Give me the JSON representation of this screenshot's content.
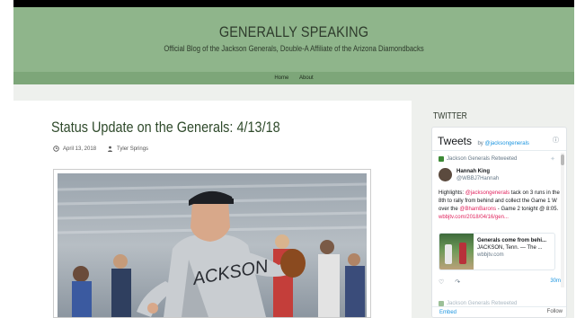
{
  "site": {
    "title": "GENERALLY SPEAKING",
    "tagline": "Official Blog of the Jackson Generals, Double-A Affiliate of the Arizona Diamondbacks"
  },
  "nav": {
    "items": [
      "Home",
      "About"
    ]
  },
  "post": {
    "title": "Status Update on the Generals: 4/13/18",
    "date": "April 13, 2018",
    "author": "Tyler Springs",
    "photo_jersey_text": "ACKSON"
  },
  "sidebar": {
    "title": "TWITTER",
    "widget": {
      "heading": "Tweets",
      "by": "by",
      "handle": "@jacksongenerals",
      "info_icon": "info-icon",
      "retweeted_label": "Jackson Generals Retweeted",
      "tweet": {
        "name": "Hannah King",
        "handle": "@WBBJ7Hannah",
        "text_before": "Highlights: ",
        "mention": "@jacksongenerals",
        "text_mid": " tack on 3 runs in the 8th to rally from behind and collect the Game 1 W over the ",
        "mention2": "@BhamBarons",
        "text_after": " - Game 2 tonight @ 8:05. ",
        "link": "wbbjtv.com/2018/04/16/gen...",
        "card_title": "Generals come from behi...",
        "card_desc": "JACKSON, Tenn. — The ...",
        "card_url": "wbbjtv.com",
        "time": "30m"
      },
      "next_retweeted_label": "Jackson Generals Retweeted",
      "footer_embed": "Embed",
      "footer_right": "Follow"
    }
  },
  "colors": {
    "header_bg": "#8fb58b",
    "nav_bg": "#7da679",
    "title_color": "#2f4a2b",
    "twitter_blue": "#1b95e0",
    "mention_color": "#e0245e"
  }
}
